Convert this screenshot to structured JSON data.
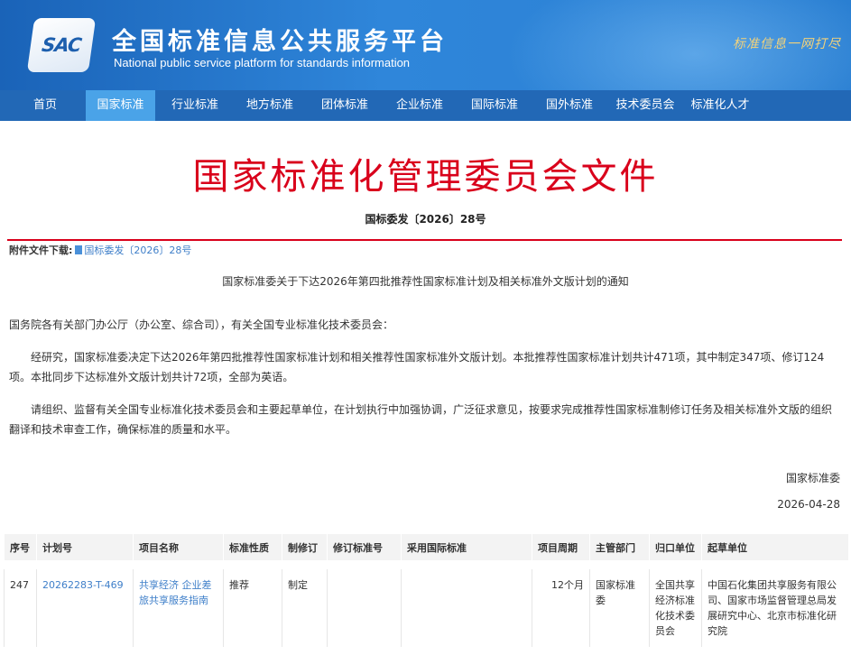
{
  "site": {
    "logo_text": "SAC",
    "title": "全国标准信息公共服务平台",
    "subtitle": "National public service platform  for standards information",
    "slogan": "标准信息一网打尽"
  },
  "nav": {
    "items": [
      {
        "label": "首页"
      },
      {
        "label": "国家标准",
        "active": true
      },
      {
        "label": "行业标准"
      },
      {
        "label": "地方标准"
      },
      {
        "label": "团体标准"
      },
      {
        "label": "企业标准"
      },
      {
        "label": "国际标准"
      },
      {
        "label": "国外标准"
      },
      {
        "label": "技术委员会"
      },
      {
        "label": "标准化人才"
      }
    ]
  },
  "document": {
    "header": "国家标准化管理委员会文件",
    "number": "国标委发〔2026〕28号",
    "attachment_label": "附件文件下载:",
    "attachment_link": "国标委发〔2026〕28号",
    "notice_title": "国家标准委关于下达2026年第四批推荐性国家标准计划及相关标准外文版计划的通知",
    "paragraphs": [
      "国务院各有关部门办公厅（办公室、综合司），有关全国专业标准化技术委员会：",
      "经研究，国家标准委决定下达2026年第四批推荐性国家标准计划和相关推荐性国家标准外文版计划。本批推荐性国家标准计划共计471项，其中制定347项、修订124项。本批同步下达标准外文版计划共计72项，全部为英语。",
      "请组织、监督有关全国专业标准化技术委员会和主要起草单位，在计划执行中加强协调，广泛征求意见，按要求完成推荐性国家标准制修订任务及相关标准外文版的组织翻译和技术审查工作，确保标准的质量和水平。"
    ],
    "signer": "国家标准委",
    "date": "2026-04-28"
  },
  "table": {
    "headers": [
      "序号",
      "计划号",
      "项目名称",
      "标准性质",
      "制修订",
      "修订标准号",
      "采用国际标准",
      "项目周期",
      "主管部门",
      "归口单位",
      "起草单位"
    ],
    "rows": [
      {
        "seq": "247",
        "plan_no": "20262283-T-469",
        "name": "共享经济 企业差旅共享服务指南",
        "nature": "推荐",
        "type": "制定",
        "revised_no": "",
        "intl_std": "",
        "period": "12个月",
        "dept": "国家标准委",
        "unit": "全国共享经济标准化技术委员会",
        "drafters": "中国石化集团共享服务有限公司、国家市场监督管理总局发展研究中心、北京市标准化研究院"
      }
    ]
  },
  "colors": {
    "banner": "#2a7fd2",
    "nav": "#2268b6",
    "nav_active": "#4aa3e8",
    "header_red": "#d9001b",
    "link": "#3f7fc9"
  }
}
